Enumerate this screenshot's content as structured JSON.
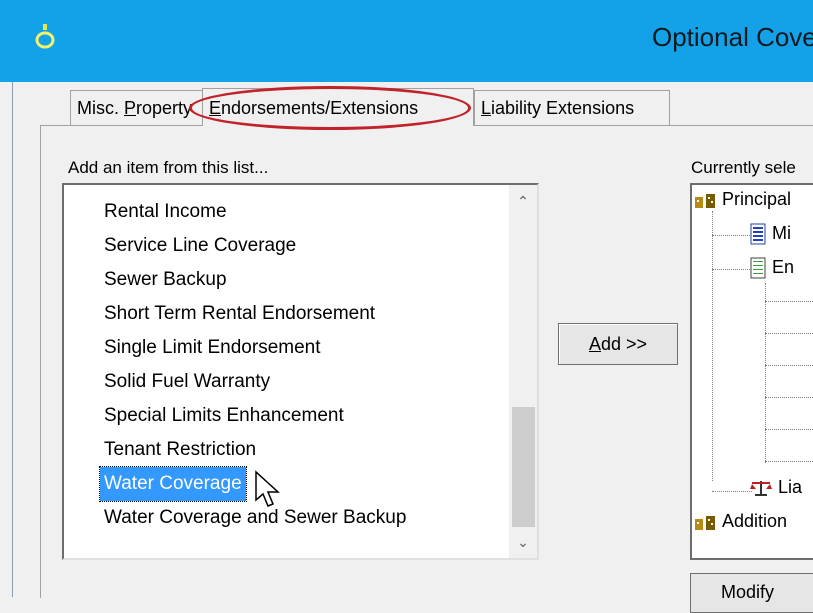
{
  "window": {
    "title": "Optional Cove"
  },
  "tabs": [
    {
      "pre": "Misc. ",
      "key": "P",
      "post": "roperty"
    },
    {
      "pre": "",
      "key": "E",
      "post": "ndorsements/Extensions"
    },
    {
      "pre": "",
      "key": "L",
      "post": "iability Extensions"
    }
  ],
  "available": {
    "label": "Add an item from this list...",
    "items": [
      "Rental Income",
      "Service Line Coverage",
      "Sewer Backup",
      "Short Term Rental Endorsement",
      "Single Limit Endorsement",
      "Solid Fuel Warranty",
      "Special Limits Enhancement",
      "Tenant Restriction",
      "Water Coverage",
      "Water Coverage and Sewer Backup"
    ],
    "selected_index": 8
  },
  "add_button": {
    "key": "A",
    "post": "dd >>"
  },
  "selected_panel": {
    "label": "Currently sele",
    "tree": {
      "principal": "Principal",
      "misc": "Mi",
      "endorse": "En",
      "liability": "Lia",
      "additional": "Addition"
    }
  },
  "modify_button": {
    "label": "Modify"
  }
}
